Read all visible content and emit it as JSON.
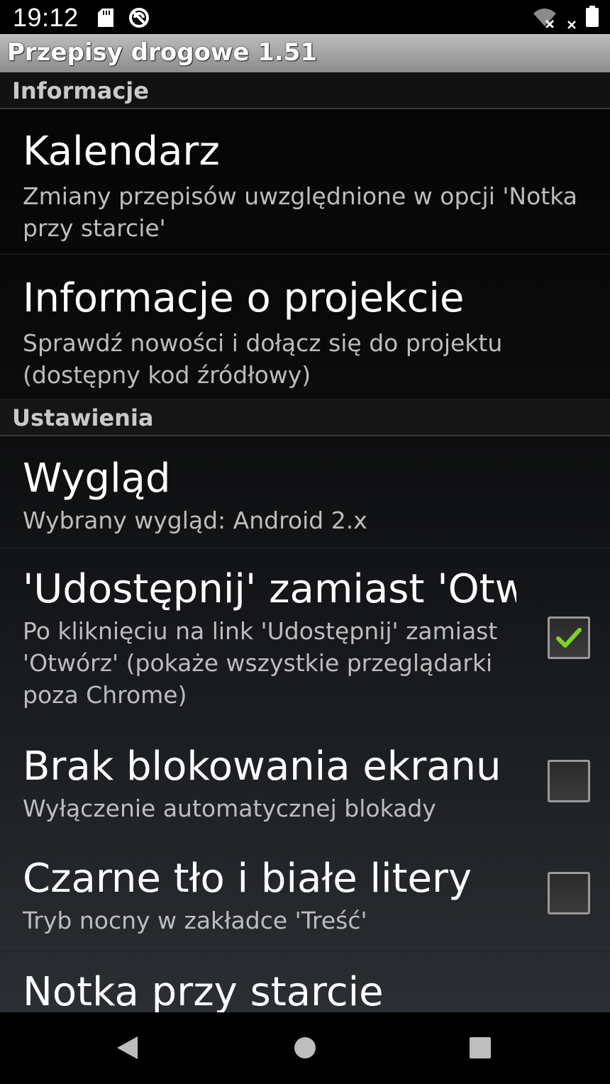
{
  "status_bar": {
    "time": "19:12",
    "left_icons": [
      "sd-card-icon",
      "no-sync-icon"
    ],
    "right_icons": [
      "wifi-off-icon",
      "signal-off-icon",
      "battery-icon"
    ]
  },
  "app_bar": {
    "title": "Przepisy drogowe 1.51"
  },
  "sections": {
    "info": {
      "header": "Informacje",
      "items": [
        {
          "title": "Kalendarz",
          "summary": "Zmiany przepisów uwzględnione w opcji 'Notka przy starcie'"
        },
        {
          "title": "Informacje o projekcie",
          "summary": "Sprawdź nowości i dołącz się do projektu (dostępny kod źródłowy)"
        }
      ]
    },
    "settings": {
      "header": "Ustawienia",
      "items": [
        {
          "title": "Wygląd",
          "summary": "Wybrany wygląd: Android 2.x"
        },
        {
          "title": "'Udostępnij' zamiast 'Otw..",
          "summary": "Po kliknięciu na link 'Udostępnij' zamiast 'Otwórz' (pokaże wszystkie przeglądarki poza Chrome)",
          "checked": true
        },
        {
          "title": "Brak blokowania ekranu",
          "summary": "Wyłączenie automatycznej blokady",
          "checked": false
        },
        {
          "title": "Czarne tło i białe litery",
          "summary": "Tryb nocny w zakładce 'Treść'",
          "checked": false
        },
        {
          "title": "Notka przy starcie",
          "summary": ""
        }
      ]
    }
  },
  "nav_bar": {
    "buttons": [
      "back-icon",
      "home-icon",
      "recents-icon"
    ]
  },
  "colors": {
    "checkmark": "#7ed321",
    "title_bar": "#a8a8a8",
    "section_header_text": "#c9c9c9",
    "summary_text": "#bdbdbd"
  }
}
